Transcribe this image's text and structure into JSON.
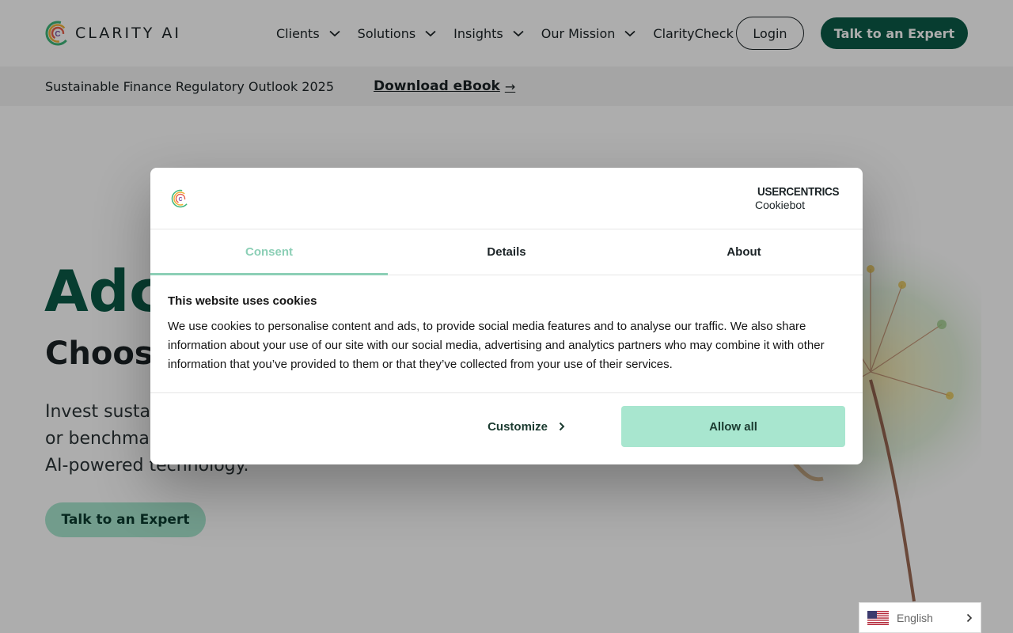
{
  "header": {
    "logo_text": "CLARITY AI",
    "nav": [
      {
        "label": "Clients",
        "has_dropdown": true
      },
      {
        "label": "Solutions",
        "has_dropdown": true
      },
      {
        "label": "Insights",
        "has_dropdown": true
      },
      {
        "label": "Our Mission",
        "has_dropdown": true
      },
      {
        "label": "ClarityCheck",
        "has_dropdown": false
      }
    ],
    "login_label": "Login",
    "cta_label": "Talk to an Expert"
  },
  "banner": {
    "text": "Sustainable Finance Regulatory Outlook 2025",
    "link_label": "Download eBook",
    "link_icon": "arrow-right-icon"
  },
  "hero": {
    "title": "Adc",
    "subtitle": "Choos",
    "text": "Invest susta… or benchma… AI-powered technology.",
    "text_lines": [
      "Invest susta",
      "or benchma",
      "AI-powered technology."
    ],
    "cta_label": "Talk to an Expert"
  },
  "cookie_dialog": {
    "brand_name": "USERCENTRICS",
    "brand_sub": "Cookiebot",
    "tabs": [
      {
        "label": "Consent",
        "active": true
      },
      {
        "label": "Details",
        "active": false
      },
      {
        "label": "About",
        "active": false
      }
    ],
    "title": "This website uses cookies",
    "body": "We use cookies to personalise content and ads, to provide social media features and to analyse our traffic. We also share information about your use of our site with our social media, advertising and analytics partners who may combine it with other information that you’ve provided to them or that they’ve collected from your use of their services.",
    "customize_label": "Customize",
    "allow_all_label": "Allow all"
  },
  "language": {
    "label": "English",
    "flag": "us-flag-icon"
  },
  "colors": {
    "brand_green": "#0b5a47",
    "mint": "#a8e6cf",
    "tab_active": "#8ccfb6"
  }
}
